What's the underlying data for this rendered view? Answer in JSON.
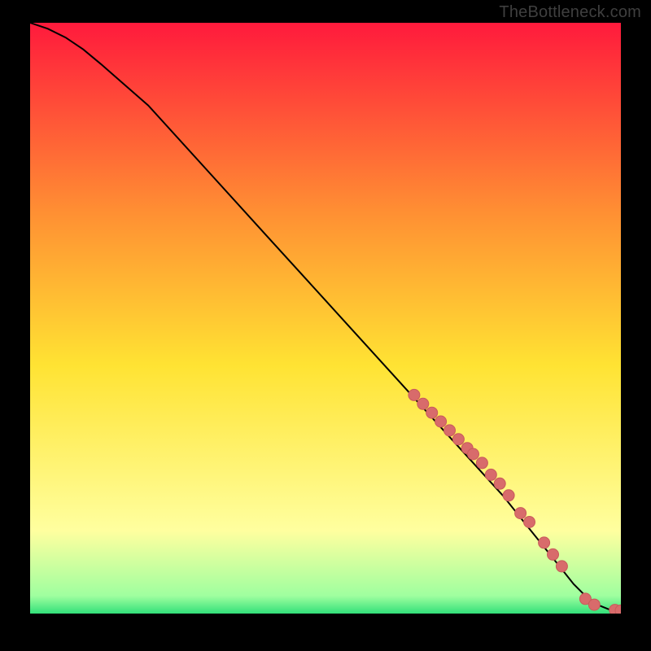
{
  "attribution": "TheBottleneck.com",
  "colors": {
    "background": "#000000",
    "gradient_top": "#ff1a3c",
    "gradient_mid_upper": "#ff8f33",
    "gradient_mid": "#ffe333",
    "gradient_lower": "#ffff9f",
    "gradient_bottom": "#33e07a",
    "curve": "#000000",
    "marker_fill": "#d86b6b",
    "marker_stroke": "#c85a5a"
  },
  "chart_data": {
    "type": "line",
    "title": "",
    "xlabel": "",
    "ylabel": "",
    "xlim": [
      0,
      100
    ],
    "ylim": [
      0,
      100
    ],
    "curve": {
      "x": [
        0,
        3,
        6,
        9,
        12,
        16,
        20,
        30,
        40,
        50,
        60,
        70,
        80,
        84,
        86,
        88,
        90,
        92,
        94,
        96,
        98,
        100
      ],
      "y": [
        100,
        99,
        97.5,
        95.5,
        93,
        89.5,
        86,
        75,
        64,
        53,
        42,
        31,
        20,
        15,
        12.5,
        10,
        7.5,
        5,
        3,
        1.5,
        0.7,
        0.5
      ]
    },
    "markers": {
      "x": [
        65,
        66.5,
        68,
        69.5,
        71,
        72.5,
        74,
        75,
        76.5,
        78,
        79.5,
        81,
        83,
        84.5,
        87,
        88.5,
        90,
        94,
        95.5,
        99,
        100
      ],
      "y": [
        37,
        35.5,
        34,
        32.5,
        31,
        29.5,
        28,
        27,
        25.5,
        23.5,
        22,
        20,
        17,
        15.5,
        12,
        10,
        8,
        2.5,
        1.5,
        0.6,
        0.5
      ]
    }
  }
}
